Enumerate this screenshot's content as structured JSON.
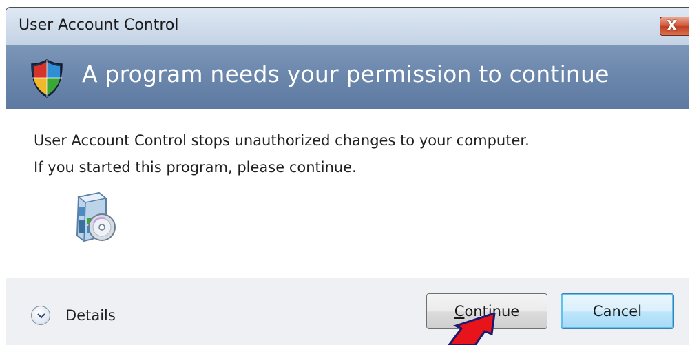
{
  "window": {
    "title": "User Account Control",
    "close_label": "X"
  },
  "header": {
    "text": "A program needs your permission to continue",
    "icon": "shield-icon"
  },
  "body": {
    "line1": "User Account Control stops unauthorized changes to your computer.",
    "line2": "If you started this program, please continue.",
    "program_icon": "software-box-icon"
  },
  "footer": {
    "details_label": "Details",
    "continue_label": "Continue",
    "continue_mnemonic": "C",
    "continue_rest": "ontinue",
    "cancel_label": "Cancel"
  },
  "colors": {
    "header_band": "#6a86ab",
    "annotation_arrow": "#e8141b",
    "cancel_focus": "#5fc3ef"
  }
}
